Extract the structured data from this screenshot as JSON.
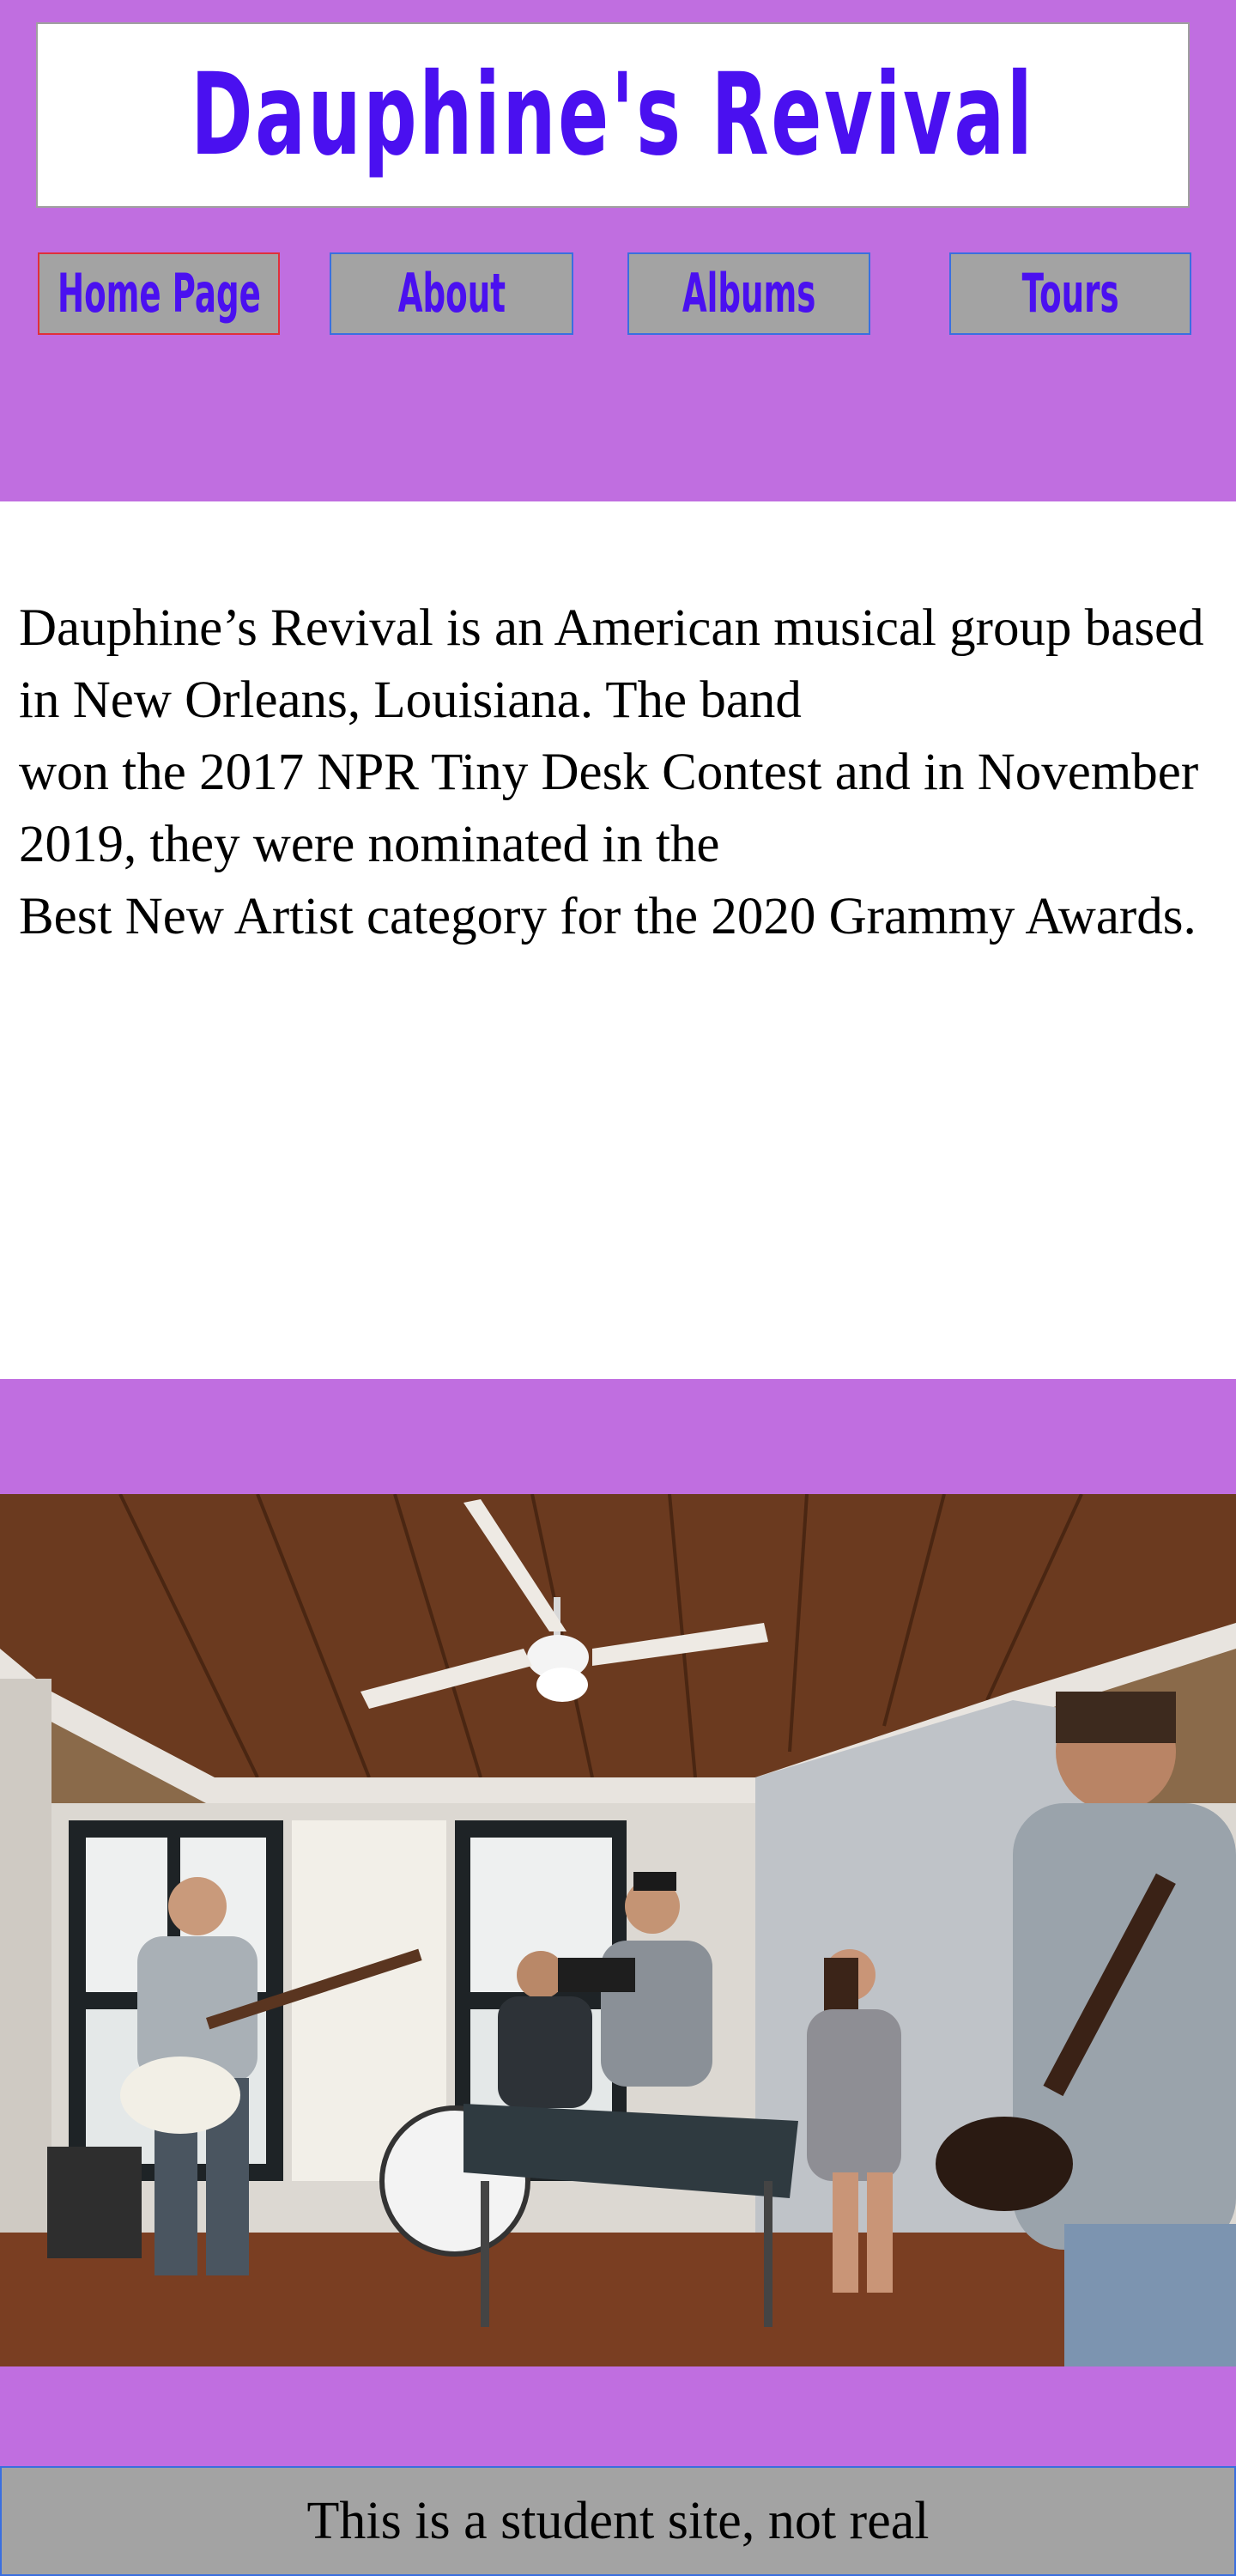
{
  "header": {
    "site_title": "Dauphine's Revival"
  },
  "nav": {
    "items": [
      {
        "label": "Home Page",
        "active": true
      },
      {
        "label": "About",
        "active": false
      },
      {
        "label": "Albums",
        "active": false
      },
      {
        "label": "Tours",
        "active": false
      }
    ]
  },
  "main": {
    "intro_text": "Dauphine’s Revival is an American musical group based in New Orleans, Louisiana. The band\nwon the 2017 NPR Tiny Desk Contest and in November 2019, they were nominated in the\nBest New Artist category for the 2020 Grammy Awards."
  },
  "photo": {
    "subject": "band performing in a room with wood-paneled ceiling and ceiling fan"
  },
  "footer": {
    "text": "This is a student site, not real"
  },
  "colors": {
    "page_background": "#c06ee0",
    "title_color": "#4a10f0",
    "nav_button_background": "#a3a3a3",
    "nav_border": "#3a6fe0",
    "active_nav_border": "#e0303a"
  }
}
